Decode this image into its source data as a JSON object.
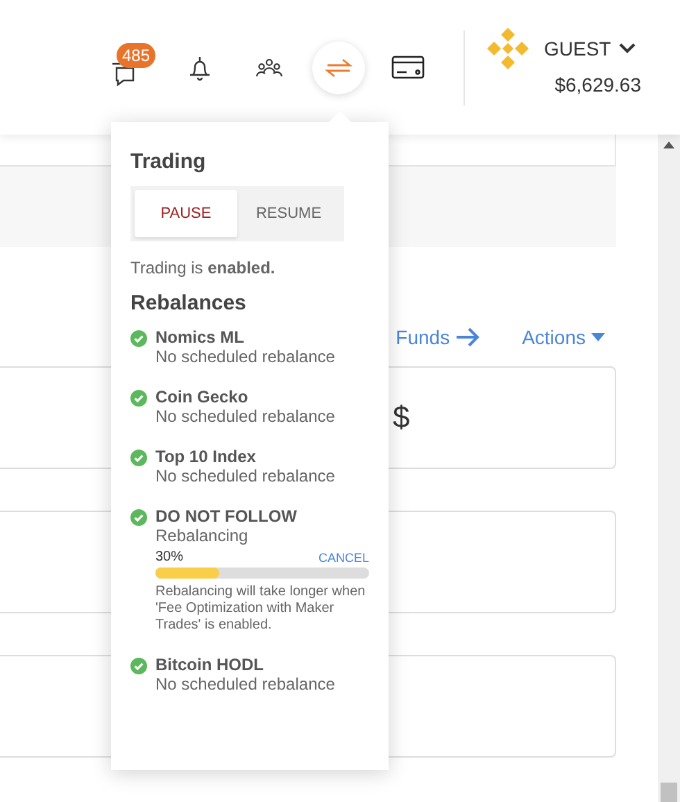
{
  "header": {
    "notifications_badge": "485",
    "icons": [
      {
        "kind": "chat",
        "selected": false
      },
      {
        "kind": "bell",
        "selected": false
      },
      {
        "kind": "people",
        "selected": false
      },
      {
        "kind": "trading",
        "selected": true
      },
      {
        "kind": "card",
        "selected": false
      }
    ],
    "account": {
      "name": "GUEST",
      "balance": "$6,629.63"
    }
  },
  "links": {
    "funds": "Funds",
    "actions": "Actions"
  },
  "cards": [
    {
      "kind": "value",
      "value": "$"
    },
    {
      "kind": "blank"
    },
    {
      "kind": "blank"
    }
  ],
  "trading_popover": {
    "title": "Trading",
    "buttons": [
      {
        "label": "PAUSE",
        "selected": true
      },
      {
        "label": "RESUME",
        "selected": false
      }
    ],
    "status": "Trading is **enabled.**",
    "rebalances_title": "Rebalances",
    "rebalances": [
      {
        "kind": "idle",
        "name": "Nomics ML",
        "status": "No scheduled rebalance"
      },
      {
        "kind": "idle",
        "name": "Coin Gecko",
        "status": "No scheduled rebalance"
      },
      {
        "kind": "idle",
        "name": "Top 10 Index",
        "status": "No scheduled rebalance"
      },
      {
        "kind": "progress",
        "name": "DO NOT FOLLOW",
        "status": "Rebalancing",
        "percent": "30%",
        "level": 0.3,
        "cancel": "CANCEL",
        "note": "Rebalancing will take longer when 'Fee Optimization with Maker Trades' is enabled."
      },
      {
        "kind": "idle",
        "name": "Bitcoin HODL",
        "status": "No scheduled rebalance"
      }
    ]
  }
}
